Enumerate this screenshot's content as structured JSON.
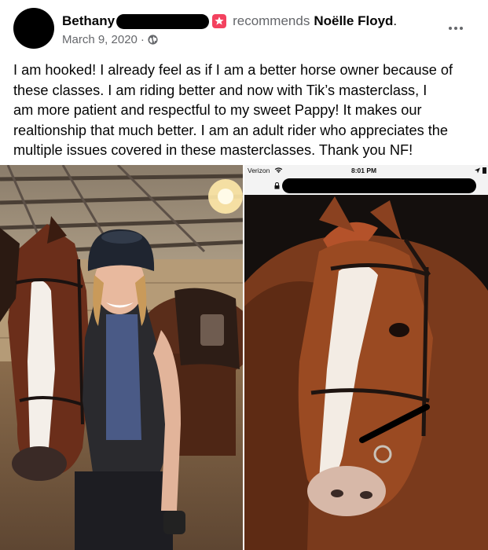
{
  "post": {
    "author": "Bethany",
    "action": "recommends",
    "page_name": "Noëlle Floyd",
    "page_name_suffix": ".",
    "date": "March 9, 2020",
    "meta_separator": "·",
    "privacy_icon": "globe-icon",
    "recommend_icon": "recommend-star-icon",
    "more_icon": "more-options-icon",
    "body_lines": [
      "I am hooked!  I already feel as if I am a better horse owner because of",
      "these classes.  I am riding better and now with Tik’s masterclass,  I",
      "am more patient and respectful to my sweet Pappy!  It makes our",
      "realtionship that much better.  I am an adult rider who appreciates the",
      "multiple issues covered in these masterclasses.  Thank you NF!"
    ]
  },
  "photos": {
    "left": {
      "description_icon": "photo-rider-with-horse"
    },
    "right": {
      "carrier": "Verizon",
      "time": "8:01 PM",
      "wifi_icon": "wifi-icon",
      "location_icon": "location-arrow-icon",
      "lock_icon": "lock-icon"
    }
  },
  "colors": {
    "text_primary": "#050505",
    "text_secondary": "#65676b",
    "recommend_red": "#f3425f",
    "redaction": "#000000"
  }
}
